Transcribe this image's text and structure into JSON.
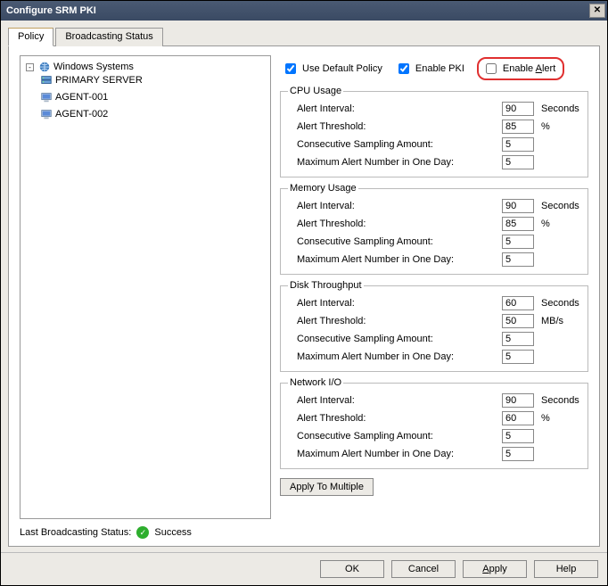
{
  "window": {
    "title": "Configure SRM PKI"
  },
  "tabs": {
    "policy": "Policy",
    "broadcasting": "Broadcasting Status"
  },
  "tree": {
    "root": "Windows Systems",
    "items": [
      "PRIMARY SERVER",
      "AGENT-001",
      "AGENT-002"
    ]
  },
  "checkboxes": {
    "use_default_policy": "Use Default Policy",
    "enable_pki": "Enable PKI",
    "enable_alert": "Enable Alert"
  },
  "groups": {
    "cpu": {
      "legend": "CPU Usage",
      "alert_interval_label": "Alert Interval:",
      "alert_interval_value": "90",
      "alert_interval_unit": "Seconds",
      "alert_threshold_label": "Alert Threshold:",
      "alert_threshold_value": "85",
      "alert_threshold_unit": "%",
      "sampling_label": "Consecutive Sampling Amount:",
      "sampling_value": "5",
      "max_label": "Maximum Alert Number in One Day:",
      "max_value": "5"
    },
    "memory": {
      "legend": "Memory Usage",
      "alert_interval_label": "Alert Interval:",
      "alert_interval_value": "90",
      "alert_interval_unit": "Seconds",
      "alert_threshold_label": "Alert Threshold:",
      "alert_threshold_value": "85",
      "alert_threshold_unit": "%",
      "sampling_label": "Consecutive Sampling Amount:",
      "sampling_value": "5",
      "max_label": "Maximum Alert Number in One Day:",
      "max_value": "5"
    },
    "disk": {
      "legend": "Disk Throughput",
      "alert_interval_label": "Alert Interval:",
      "alert_interval_value": "60",
      "alert_interval_unit": "Seconds",
      "alert_threshold_label": "Alert Threshold:",
      "alert_threshold_value": "50",
      "alert_threshold_unit": "MB/s",
      "sampling_label": "Consecutive Sampling Amount:",
      "sampling_value": "5",
      "max_label": "Maximum Alert Number in One Day:",
      "max_value": "5"
    },
    "network": {
      "legend": "Network I/O",
      "alert_interval_label": "Alert Interval:",
      "alert_interval_value": "90",
      "alert_interval_unit": "Seconds",
      "alert_threshold_label": "Alert Threshold:",
      "alert_threshold_value": "60",
      "alert_threshold_unit": "%",
      "sampling_label": "Consecutive Sampling Amount:",
      "sampling_value": "5",
      "max_label": "Maximum Alert Number in One Day:",
      "max_value": "5"
    }
  },
  "apply_multiple": "Apply To Multiple",
  "status": {
    "label": "Last Broadcasting Status:",
    "value": "Success"
  },
  "buttons": {
    "ok": "OK",
    "cancel": "Cancel",
    "apply": "Apply",
    "help": "Help"
  }
}
